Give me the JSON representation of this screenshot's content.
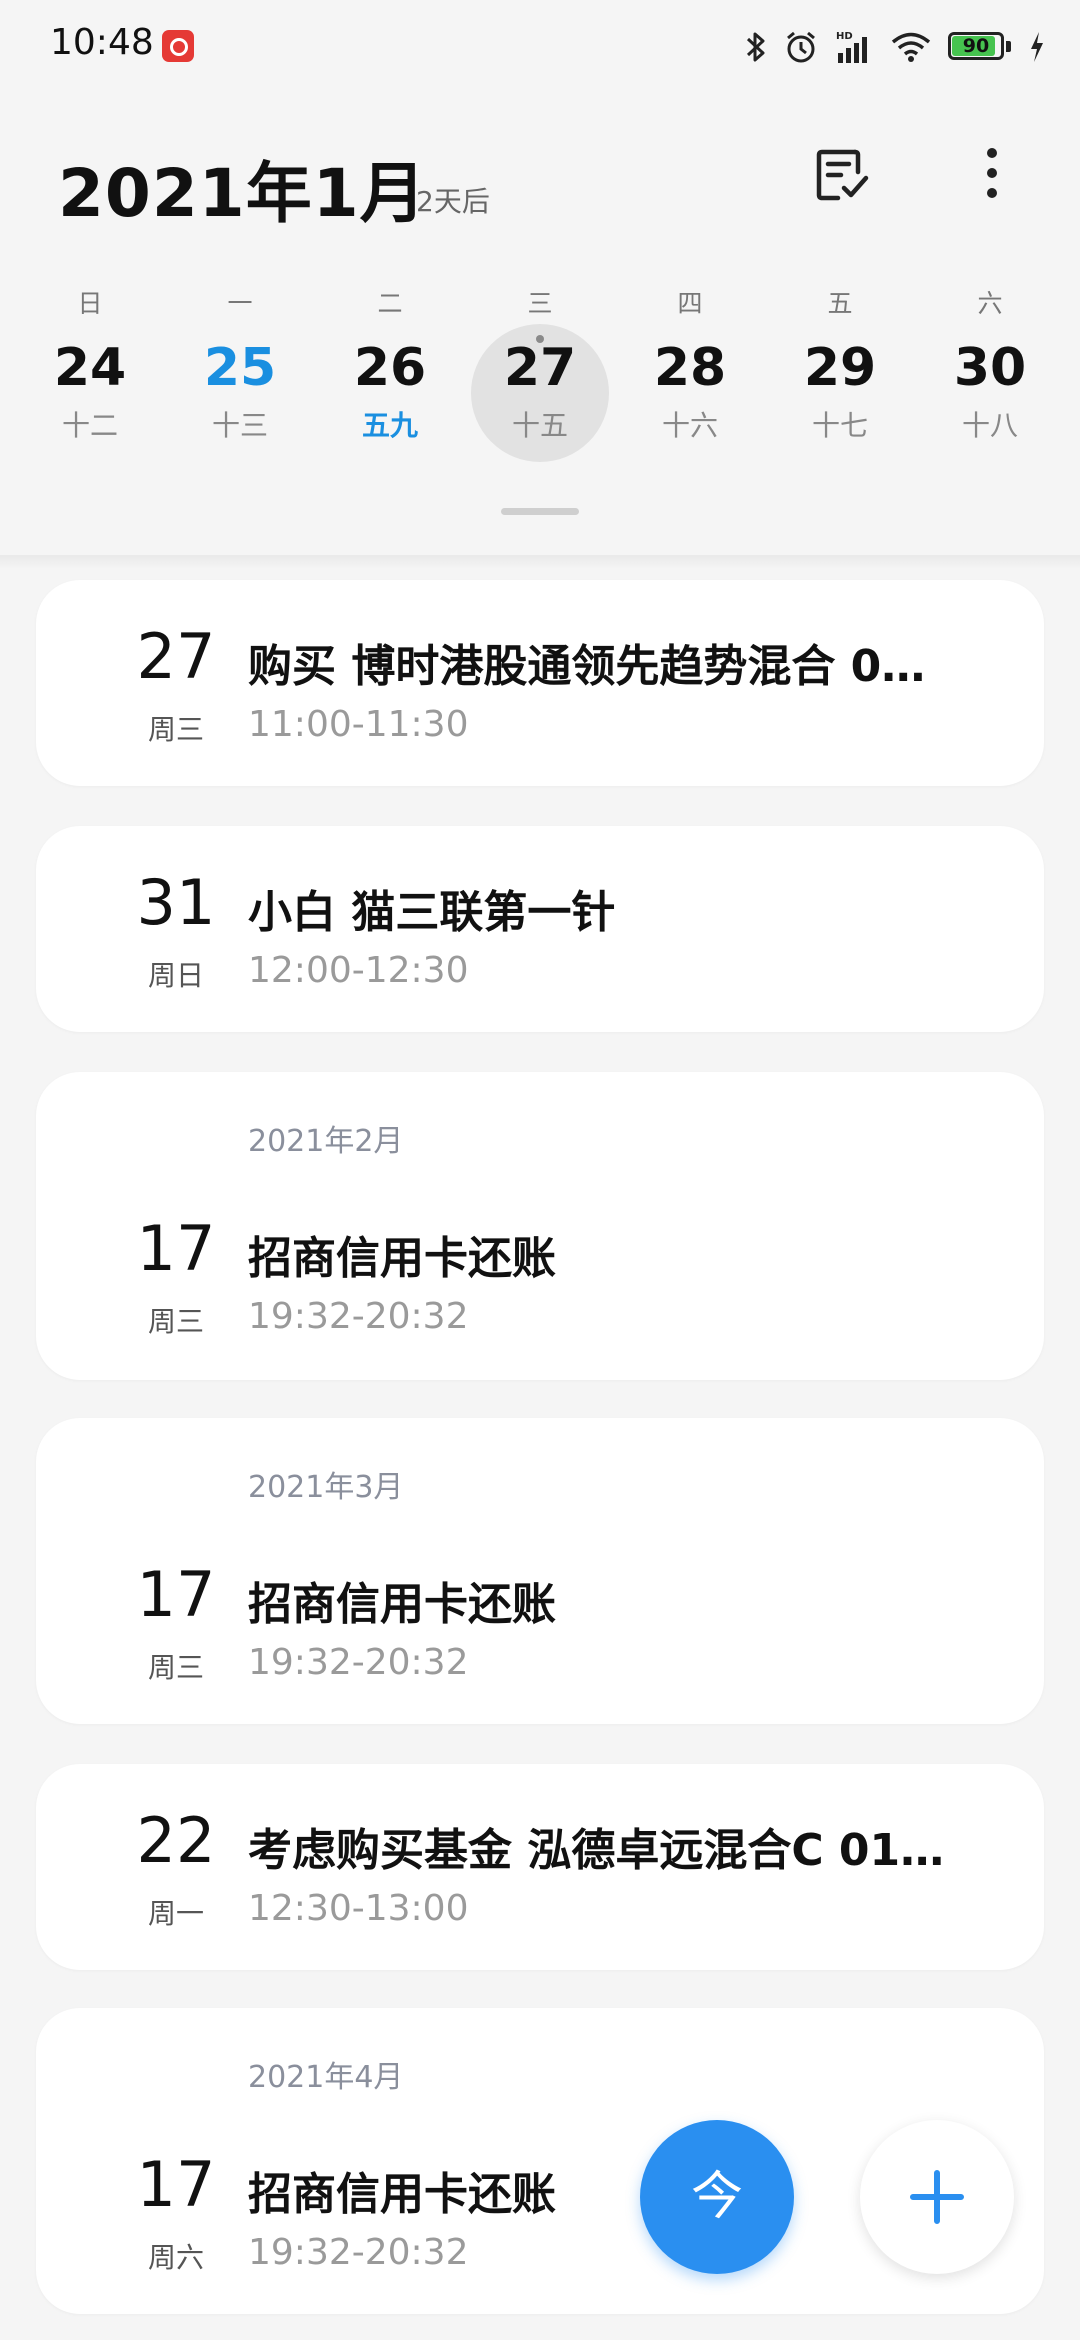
{
  "status_bar": {
    "time": "10:48",
    "battery_level": "90",
    "icons": [
      "netease-music-icon",
      "bluetooth-icon",
      "alarm-icon",
      "signal-hd-icon",
      "wifi-icon",
      "battery-icon",
      "charging-icon"
    ]
  },
  "header": {
    "title": "2021年1月",
    "subtitle": "2天后",
    "tasks_icon": "tasks-icon",
    "more_icon": "more-vertical-icon"
  },
  "week": {
    "days": [
      {
        "dow": "日",
        "day": "24",
        "lunar": "十二"
      },
      {
        "dow": "一",
        "day": "25",
        "lunar": "十三"
      },
      {
        "dow": "二",
        "day": "26",
        "lunar": "五九"
      },
      {
        "dow": "三",
        "day": "27",
        "lunar": "十五"
      },
      {
        "dow": "四",
        "day": "28",
        "lunar": "十六"
      },
      {
        "dow": "五",
        "day": "29",
        "lunar": "十七"
      },
      {
        "dow": "六",
        "day": "30",
        "lunar": "十八"
      }
    ]
  },
  "events": [
    {
      "date": "27",
      "weekday": "周三",
      "title": "购买 博时港股通领先趋势混合 0…",
      "time": "11:00-11:30"
    },
    {
      "date": "31",
      "weekday": "周日",
      "title": "小白 猫三联第一针",
      "time": "12:00-12:30"
    },
    {
      "month": "2021年2月",
      "date": "17",
      "weekday": "周三",
      "title": "招商信用卡还账",
      "time": "19:32-20:32"
    },
    {
      "month": "2021年3月",
      "date": "17",
      "weekday": "周三",
      "title": "招商信用卡还账",
      "time": "19:32-20:32"
    },
    {
      "date": "22",
      "weekday": "周一",
      "title": "考虑购买基金 泓德卓远混合C 01…",
      "time": "12:30-13:00"
    },
    {
      "month": "2021年4月",
      "date": "17",
      "weekday": "周六",
      "title": "招商信用卡还账",
      "time": "19:32-20:32"
    }
  ],
  "fab": {
    "today_label": "今",
    "add_icon": "plus-icon"
  },
  "colors": {
    "accent": "#2a8ff0",
    "today_text": "#1a8fe0",
    "battery_green": "#46c34f"
  }
}
